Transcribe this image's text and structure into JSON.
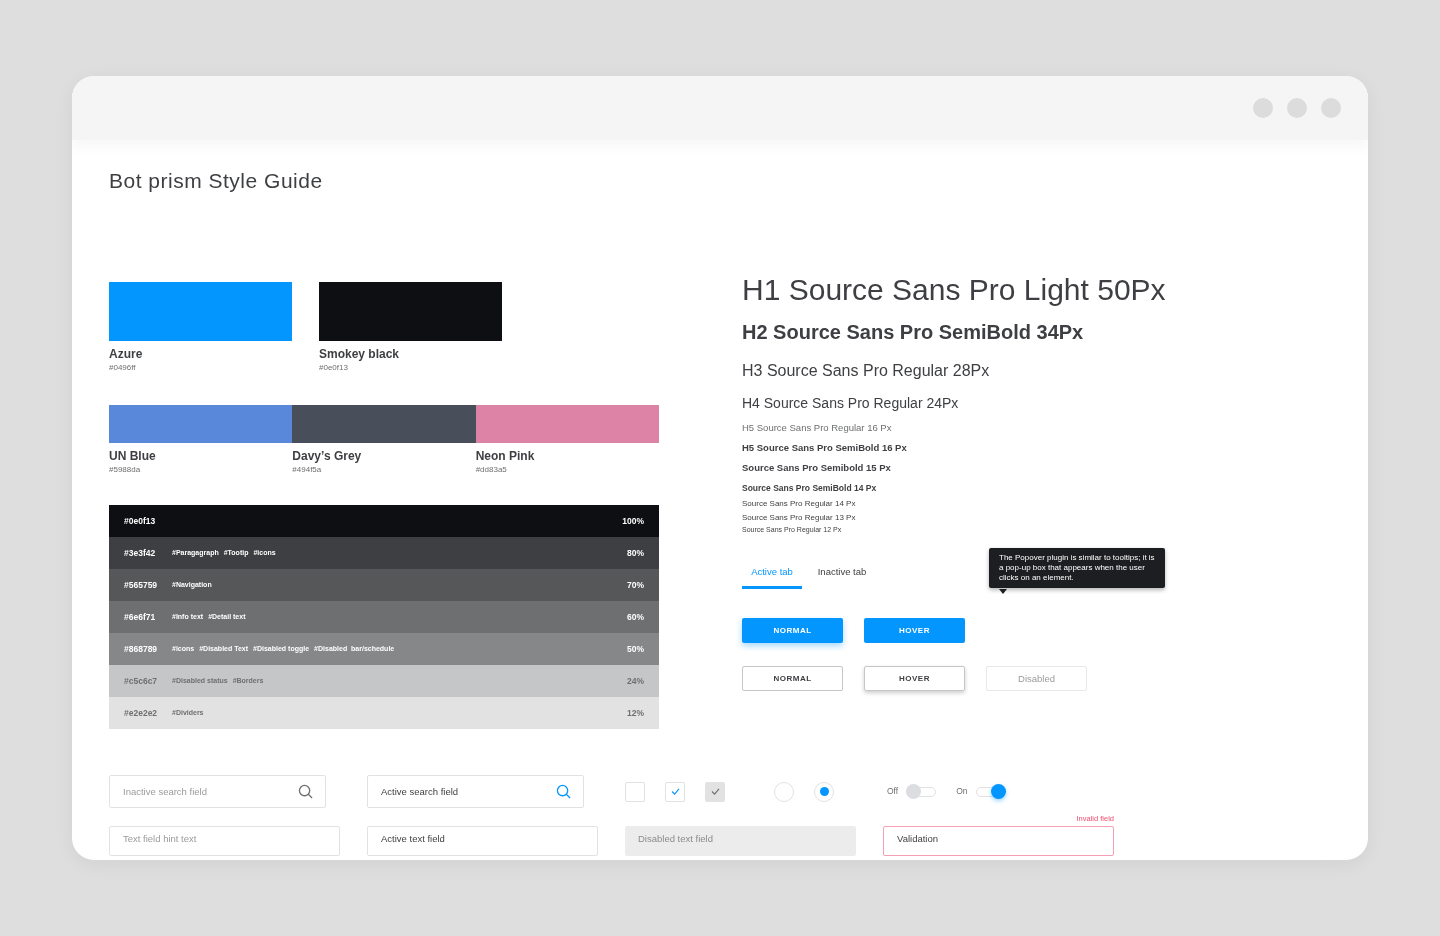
{
  "window": {
    "title": "Bot prism Style Guide"
  },
  "swatch_rows": [
    [
      {
        "name": "Azure",
        "hex": "#0496ff",
        "color": "#0496ff"
      },
      {
        "name": "Smokey black",
        "hex": "#0e0f13",
        "color": "#0e0f13"
      }
    ],
    [
      {
        "name": "UN Blue",
        "hex": "#5988da",
        "color": "#5988da"
      },
      {
        "name": "Davy’s Grey",
        "hex": "#494f5a",
        "color": "#494f5a"
      },
      {
        "name": "Neon Pink",
        "hex": "#dd83a5",
        "color": "#dd83a5"
      }
    ]
  ],
  "greys": [
    {
      "hex": "#0e0f13",
      "percent": "100%",
      "color": "#0e0f13"
    },
    {
      "hex": "#3e3f42",
      "tags": [
        "#Paragagraph",
        "#Tootip",
        "#icons"
      ],
      "percent": "80%",
      "color": "#3e3f42"
    },
    {
      "hex": "#565759",
      "tags": [
        "#Navigation"
      ],
      "percent": "70%",
      "color": "#565759"
    },
    {
      "hex": "#6e6f71",
      "tags": [
        "#Info text",
        "#Detail text"
      ],
      "percent": "60%",
      "color": "#6e6f71"
    },
    {
      "hex": "#868789",
      "tags": [
        "#icons",
        "#Disabled Text",
        "#Disabled toggle",
        "#Disabled  bar/schedule"
      ],
      "percent": "50%",
      "color": "#868789"
    },
    {
      "hex": "#c5c6c7",
      "tags": [
        "#Disabled status",
        "#Borders"
      ],
      "percent": "24%",
      "color": "#c5c6c7"
    },
    {
      "hex": "#e2e2e2",
      "tags": [
        "#Dividers"
      ],
      "percent": "12%",
      "color": "#e2e2e2"
    }
  ],
  "typography": [
    {
      "text": "H1 Source Sans Pro Light 50Px",
      "kind": "h1"
    },
    {
      "text": "H2 Source Sans Pro SemiBold 34Px",
      "kind": "h2"
    },
    {
      "text": "H3 Source Sans Pro Regular 28Px",
      "kind": "h3"
    },
    {
      "text": "H4 Source Sans Pro Regular 24Px",
      "kind": "h4"
    },
    {
      "text": "H5 Source Sans Pro Regular 16 Px",
      "kind": "h5"
    },
    {
      "text": "H5 Source Sans Pro SemiBold 16 Px",
      "kind": "h5b"
    },
    {
      "text": "Source Sans Pro Semibold 15 Px",
      "kind": "sb15"
    },
    {
      "text": "Source Sans Pro SemiBold 14 Px",
      "kind": "sb14"
    },
    {
      "text": "Source Sans Pro Regular 14 Px",
      "kind": "r14"
    },
    {
      "text": "Source Sans Pro Regular 13 Px",
      "kind": "r13"
    },
    {
      "text": "Source Sans Pro Regular 12 Px",
      "kind": "r12"
    }
  ],
  "tabs": [
    {
      "label": "Active tab",
      "selected": true
    },
    {
      "label": "Inactive tab",
      "selected": false
    }
  ],
  "tooltip": {
    "text": "The Popover plugin is similar to tooltips; it is a pop-up box that appears when the user clicks on an element."
  },
  "button_rows": [
    [
      {
        "label": "NORMAL",
        "kind": "filled",
        "hovered": false,
        "disabled": false
      },
      {
        "label": "HOVER",
        "kind": "filled",
        "hovered": true,
        "disabled": false
      }
    ],
    [
      {
        "label": "NORMAL",
        "kind": "outline",
        "hovered": false,
        "disabled": false
      },
      {
        "label": "HOVER",
        "kind": "outline",
        "hovered": true,
        "disabled": false
      },
      {
        "label": "Disabled",
        "kind": "outline",
        "hovered": false,
        "disabled": true
      }
    ]
  ],
  "search_fields": [
    {
      "placeholder": "Inactive search field",
      "active": false
    },
    {
      "value": "Active search field",
      "active": true
    }
  ],
  "checkboxes": [
    {
      "checked": false,
      "disabled": false
    },
    {
      "checked": true,
      "disabled": false
    },
    {
      "checked": true,
      "disabled": true
    }
  ],
  "radios": [
    {
      "selected": false
    },
    {
      "selected": true
    }
  ],
  "toggles": [
    {
      "label": "Off",
      "on": false
    },
    {
      "label": "On",
      "on": true
    }
  ],
  "text_fields": [
    {
      "kind": "hint",
      "placeholder": "Text field hint text"
    },
    {
      "kind": "active",
      "value": "Active text field"
    },
    {
      "kind": "disabled",
      "placeholder": "Disabled text field"
    },
    {
      "kind": "invalid",
      "value": "Validation",
      "error": "Invalid field"
    }
  ]
}
